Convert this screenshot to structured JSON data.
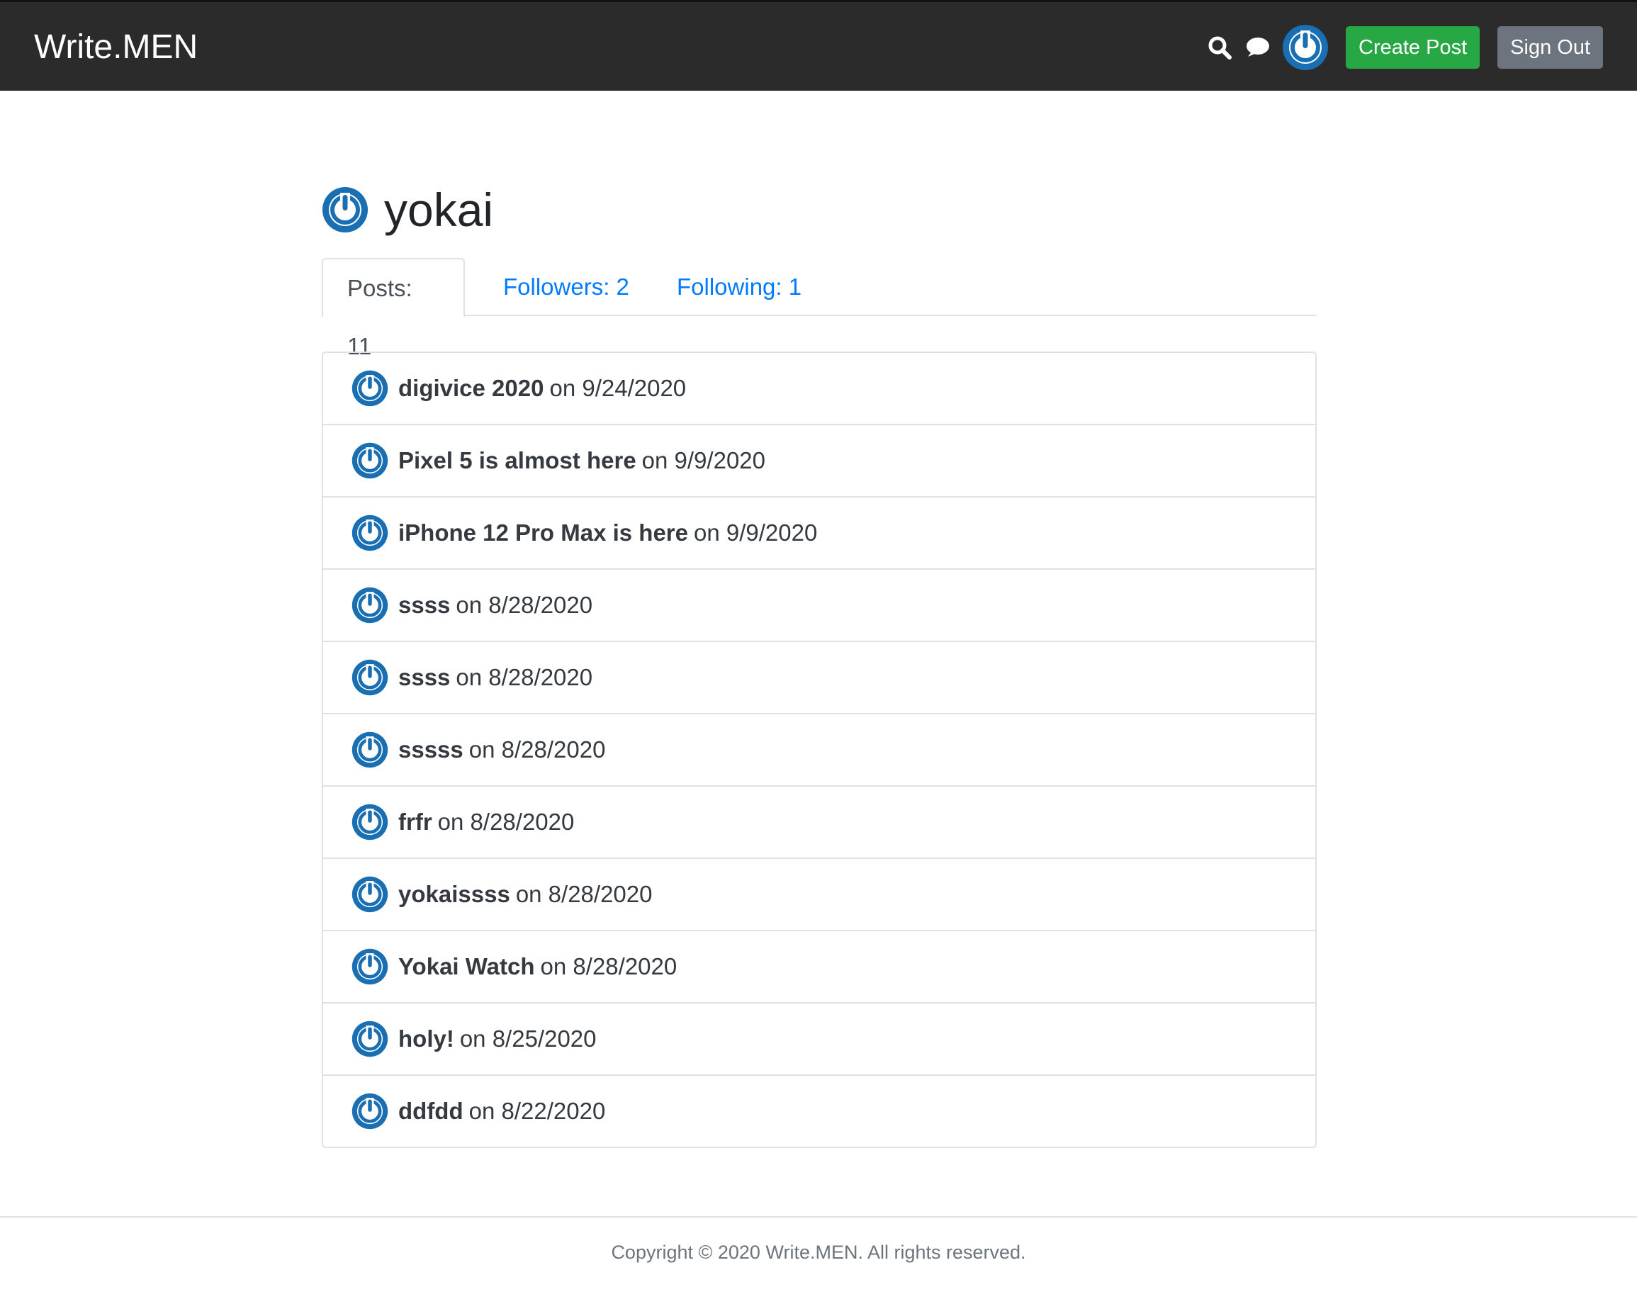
{
  "nav": {
    "brand": "Write.MEN",
    "create_post_label": "Create Post",
    "sign_out_label": "Sign Out",
    "icons": [
      "search-icon",
      "chat-icon",
      "avatar"
    ]
  },
  "profile": {
    "username": "yokai"
  },
  "tabs": [
    {
      "label": "Posts: 11",
      "active": true
    },
    {
      "label": "Followers: 2",
      "active": false
    },
    {
      "label": "Following: 1",
      "active": false
    }
  ],
  "posts": [
    {
      "title": "digivice 2020",
      "date": "on 9/24/2020"
    },
    {
      "title": "Pixel 5 is almost here",
      "date": "on 9/9/2020"
    },
    {
      "title": "iPhone 12 Pro Max is here",
      "date": "on 9/9/2020"
    },
    {
      "title": "ssss",
      "date": "on 8/28/2020"
    },
    {
      "title": "ssss",
      "date": "on 8/28/2020"
    },
    {
      "title": "sssss",
      "date": "on 8/28/2020"
    },
    {
      "title": "frfr",
      "date": "on 8/28/2020"
    },
    {
      "title": "yokaissss",
      "date": "on 8/28/2020"
    },
    {
      "title": "Yokai Watch",
      "date": "on 8/28/2020"
    },
    {
      "title": "holy!",
      "date": "on 8/25/2020"
    },
    {
      "title": "ddfdd",
      "date": "on 8/22/2020"
    }
  ],
  "footer": {
    "text": "Copyright © 2020 Write.MEN. All rights reserved."
  },
  "colors": {
    "navbar": "#2b2b2b",
    "accent_blue": "#007bff",
    "avatar_blue": "#1a6fb3",
    "create_green": "#28a745",
    "sign_out_gray": "#6c757d"
  }
}
